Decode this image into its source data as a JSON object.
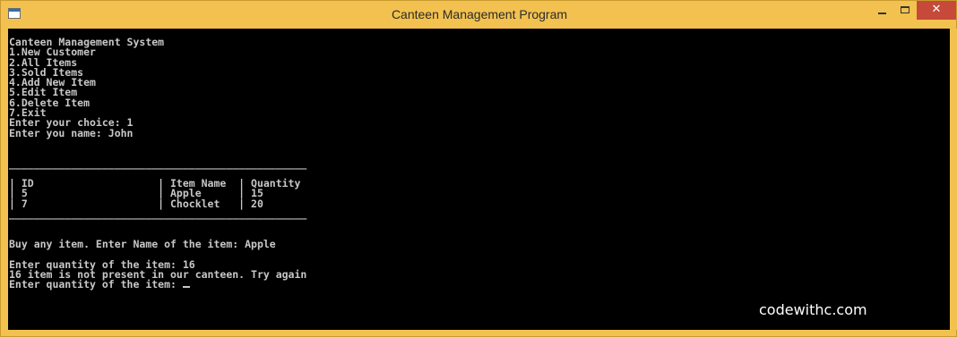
{
  "window": {
    "title": "Canteen Management Program",
    "close_glyph": "✕",
    "accent_color": "#f2c14f",
    "close_color": "#c7493a"
  },
  "console": {
    "lines": [
      "Canteen Management System",
      "1.New Customer",
      "2.All Items",
      "3.Sold Items",
      "4.Add New Item",
      "5.Edit Item",
      "6.Delete Item",
      "7.Exit",
      "Enter your choice: 1",
      "Enter you name: John",
      "",
      "",
      "________________________________________________",
      "",
      "| ID                    | Item Name  | Quantity",
      "| 5                     | Apple      | 15",
      "| 7                     | Chocklet   | 20",
      "________________________________________________",
      "",
      "",
      "Buy any item. Enter Name of the item: Apple",
      "",
      "Enter quantity of the item: 16",
      "16 item is not present in our canteen. Try again",
      "Enter quantity of the item: "
    ],
    "text_color": "#c8c8c8",
    "background": "#000000"
  },
  "watermark": "codewithc.com"
}
